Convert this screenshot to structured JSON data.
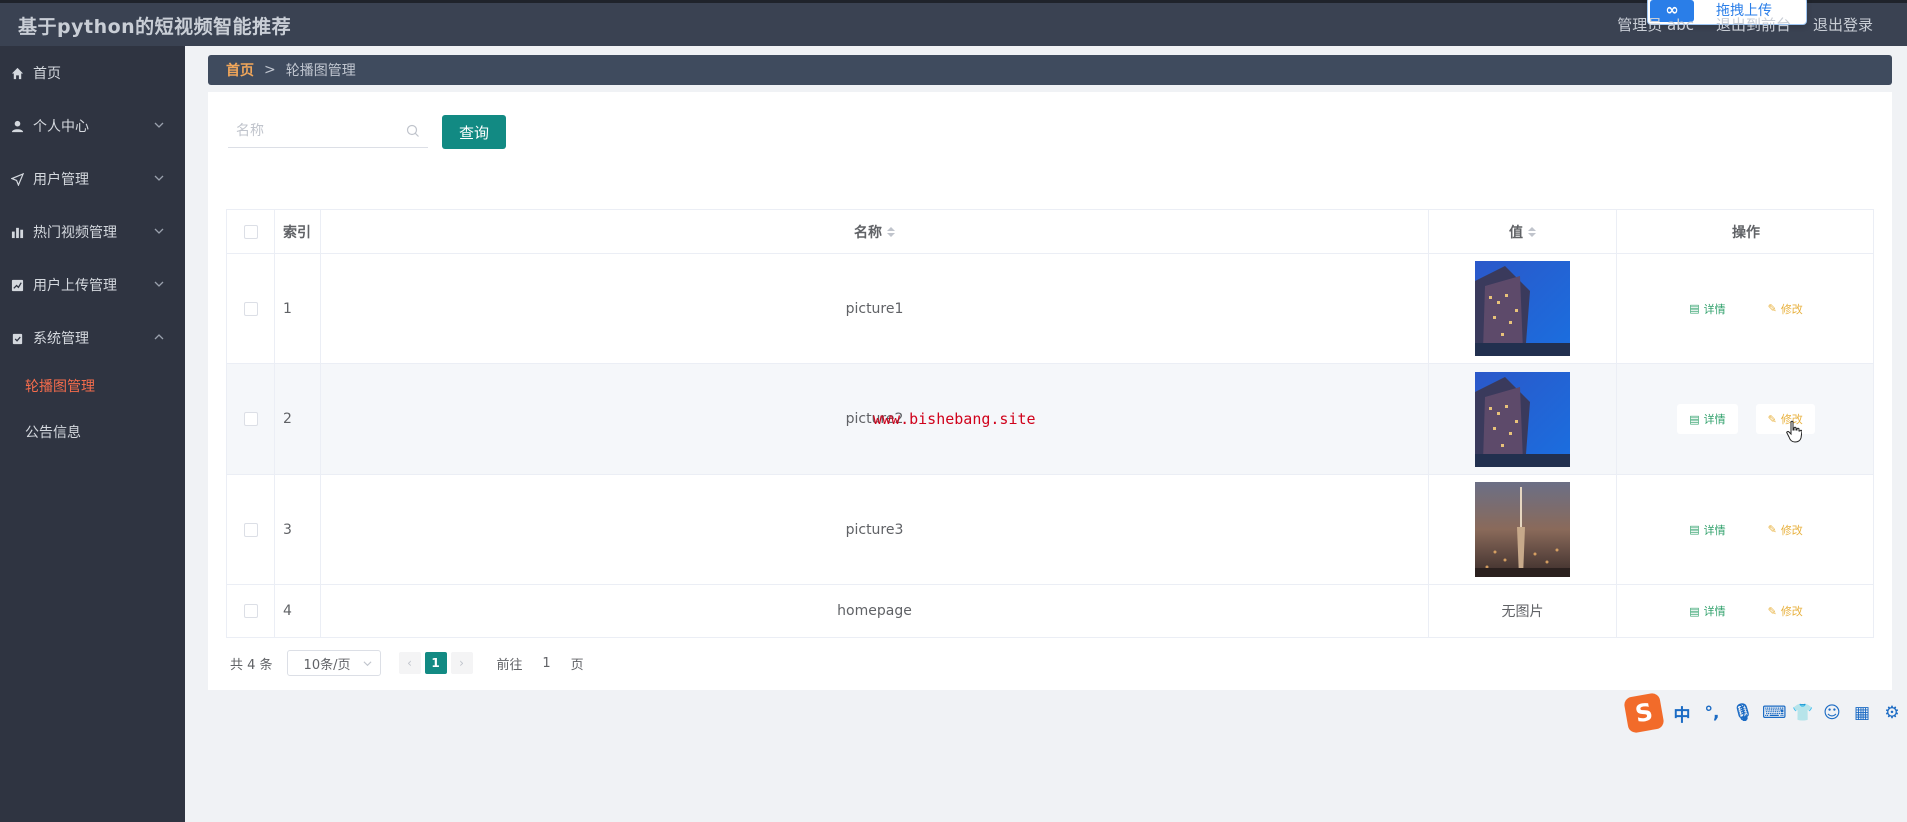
{
  "app": {
    "title": "基于python的短视频智能推荐"
  },
  "header": {
    "user": "管理员 abc",
    "back_to_front": "退出到前台",
    "logout": "退出登录",
    "upload_popup": {
      "logo": "∞",
      "label": "拖拽上传"
    }
  },
  "sidebar": {
    "items": [
      {
        "label": "首页",
        "icon": "home-icon"
      },
      {
        "label": "个人中心",
        "icon": "user-icon"
      },
      {
        "label": "用户管理",
        "icon": "send-icon"
      },
      {
        "label": "热门视频管理",
        "icon": "bar-chart-icon"
      },
      {
        "label": "用户上传管理",
        "icon": "trend-icon"
      },
      {
        "label": "系统管理",
        "icon": "clipboard-icon"
      }
    ],
    "sub_items": [
      {
        "label": "轮播图管理",
        "active": true
      },
      {
        "label": "公告信息",
        "active": false
      }
    ]
  },
  "breadcrumb": {
    "home": "首页",
    "separator": ">",
    "current": "轮播图管理"
  },
  "search": {
    "placeholder": "名称",
    "button": "查询"
  },
  "table": {
    "headers": {
      "index": "索引",
      "name": "名称",
      "value": "值",
      "actions": "操作"
    },
    "rows": [
      {
        "index": "1",
        "name": "picture1",
        "value": "image-night-building"
      },
      {
        "index": "2",
        "name": "picture2",
        "value": "image-night-building"
      },
      {
        "index": "3",
        "name": "picture3",
        "value": "image-city-tower"
      },
      {
        "index": "4",
        "name": "homepage",
        "value_text": "无图片"
      }
    ],
    "action_detail": "详情",
    "action_edit": "修改"
  },
  "watermark": "www.bishebang.site",
  "pagination": {
    "total": "共 4 条",
    "page_size": "10条/页",
    "current_page": "1",
    "goto_prefix": "前往",
    "goto_value": "1",
    "goto_suffix": "页"
  },
  "ime_toolbar": {
    "logo": "S",
    "mode": "中",
    "punct": "°,"
  },
  "colors": {
    "header_bg": "#3a4252",
    "sidebar_bg": "#2f3441",
    "accent_teal": "#128a83",
    "active_menu": "#f56c4c",
    "breadcrumb_home": "#f0a65a",
    "detail_green": "#31a16c",
    "edit_orange": "#e8b13e"
  }
}
